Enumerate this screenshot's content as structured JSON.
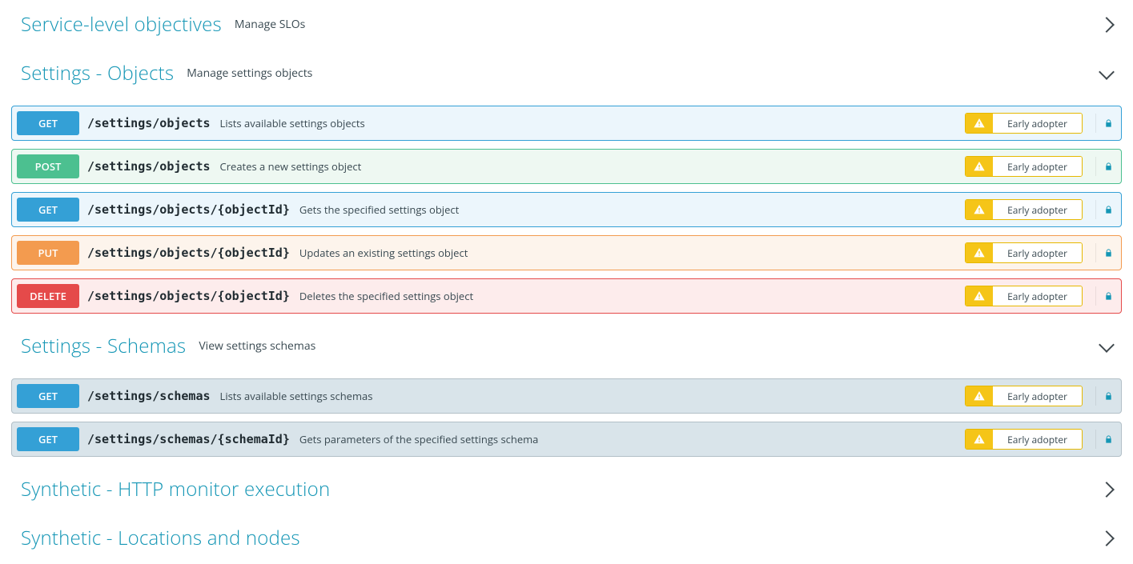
{
  "sections": [
    {
      "id": "slo",
      "title": "Service-level objectives",
      "desc": "Manage SLOs",
      "expanded": false,
      "endpoints": []
    },
    {
      "id": "settings-objects",
      "title": "Settings - Objects",
      "desc": "Manage settings objects",
      "expanded": true,
      "endpoints": [
        {
          "method": "GET",
          "class": "get",
          "path": "/settings/objects",
          "summary": "Lists available settings objects",
          "badge": "Early adopter"
        },
        {
          "method": "POST",
          "class": "post",
          "path": "/settings/objects",
          "summary": "Creates a new settings object",
          "badge": "Early adopter"
        },
        {
          "method": "GET",
          "class": "get",
          "path": "/settings/objects/{objectId}",
          "summary": "Gets the specified settings object",
          "badge": "Early adopter"
        },
        {
          "method": "PUT",
          "class": "put",
          "path": "/settings/objects/{objectId}",
          "summary": "Updates an existing settings object",
          "badge": "Early adopter"
        },
        {
          "method": "DELETE",
          "class": "delete",
          "path": "/settings/objects/{objectId}",
          "summary": "Deletes the specified settings object",
          "badge": "Early adopter"
        }
      ]
    },
    {
      "id": "settings-schemas",
      "title": "Settings - Schemas",
      "desc": "View settings schemas",
      "expanded": true,
      "endpoints": [
        {
          "method": "GET",
          "class": "get-gray",
          "path": "/settings/schemas",
          "summary": "Lists available settings schemas",
          "badge": "Early adopter"
        },
        {
          "method": "GET",
          "class": "get-gray",
          "path": "/settings/schemas/{schemaId}",
          "summary": "Gets parameters of the specified settings schema",
          "badge": "Early adopter"
        }
      ]
    },
    {
      "id": "synthetic-http",
      "title": "Synthetic - HTTP monitor execution",
      "desc": "",
      "expanded": false,
      "endpoints": []
    },
    {
      "id": "synthetic-loc",
      "title": "Synthetic - Locations and nodes",
      "desc": "",
      "expanded": false,
      "endpoints": []
    }
  ]
}
